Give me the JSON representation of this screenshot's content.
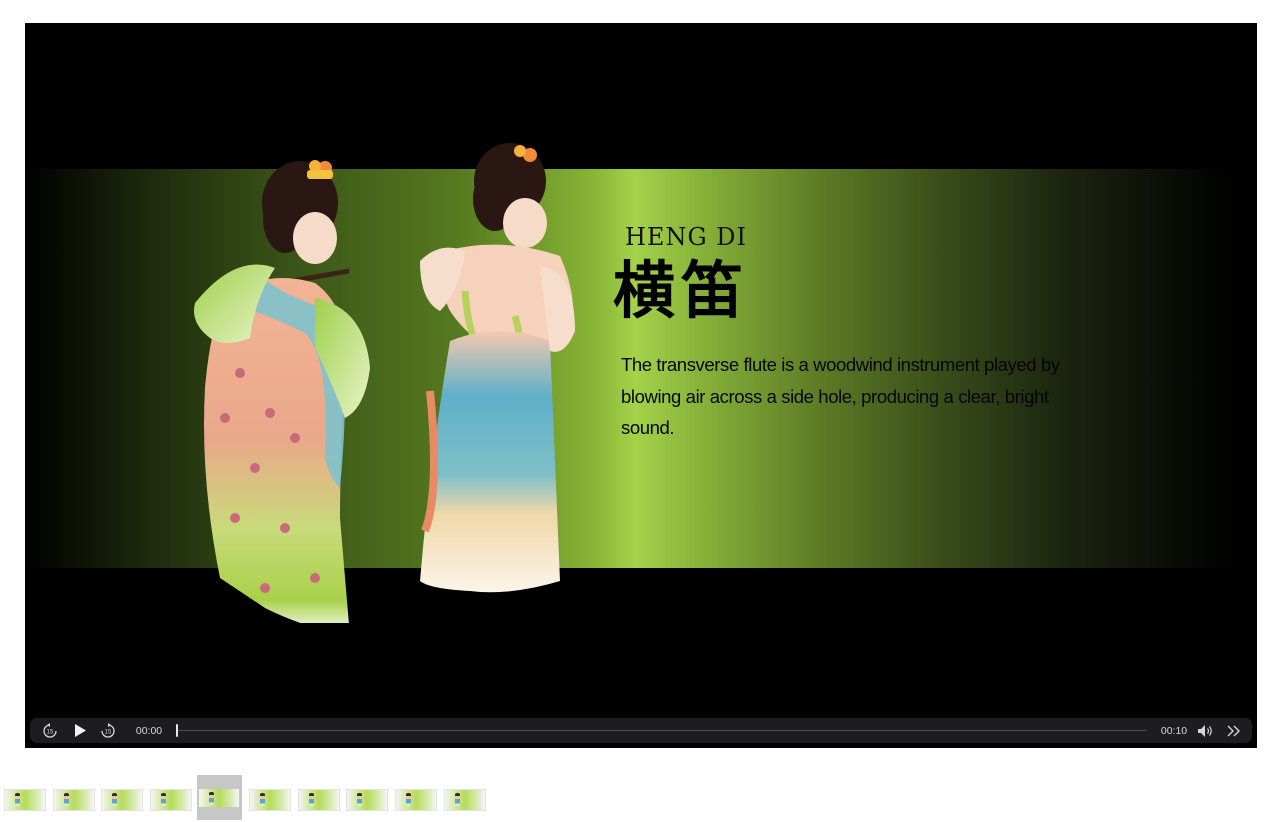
{
  "slide": {
    "romanization": "HENG DI",
    "hanzi": "横笛",
    "description": "The transverse flute is a woodwind instrument played by blowing air across a side hole, producing a clear, bright sound."
  },
  "player": {
    "current_time": "00:00",
    "duration": "00:10",
    "progress": 0,
    "rewind_seconds": "15",
    "forward_seconds": "15"
  },
  "thumbnails": {
    "count": 10,
    "active_index": 4
  },
  "colors": {
    "band_highlight": "#a4d24a",
    "controls_bg": "#1d1d21"
  }
}
